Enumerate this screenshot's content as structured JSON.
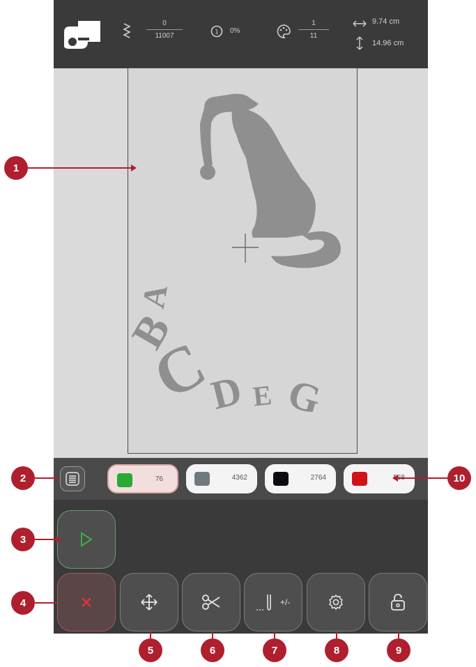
{
  "status": {
    "stitches_current": "0",
    "stitches_total": "11007",
    "progress_percent": "0%",
    "color_current": "1",
    "color_total": "11",
    "width": "9.74 cm",
    "height": "14.96 cm"
  },
  "design": {
    "letters": [
      "A",
      "B",
      "C",
      "D",
      "E",
      "G"
    ]
  },
  "colors": [
    {
      "hex": "#2ba835",
      "count": "76"
    },
    {
      "hex": "#6f7a80",
      "count": "4362"
    },
    {
      "hex": "#0a0a12",
      "count": "2764"
    },
    {
      "hex": "#d11218",
      "count": "568"
    }
  ],
  "buttons": {
    "thread_cut_label": "+/-"
  },
  "callouts": [
    "1",
    "2",
    "3",
    "4",
    "5",
    "6",
    "7",
    "8",
    "9",
    "10"
  ],
  "theme": {
    "callout": "#b01f2e",
    "start_green": "#3fae4a",
    "cancel_red": "#e0343b"
  }
}
